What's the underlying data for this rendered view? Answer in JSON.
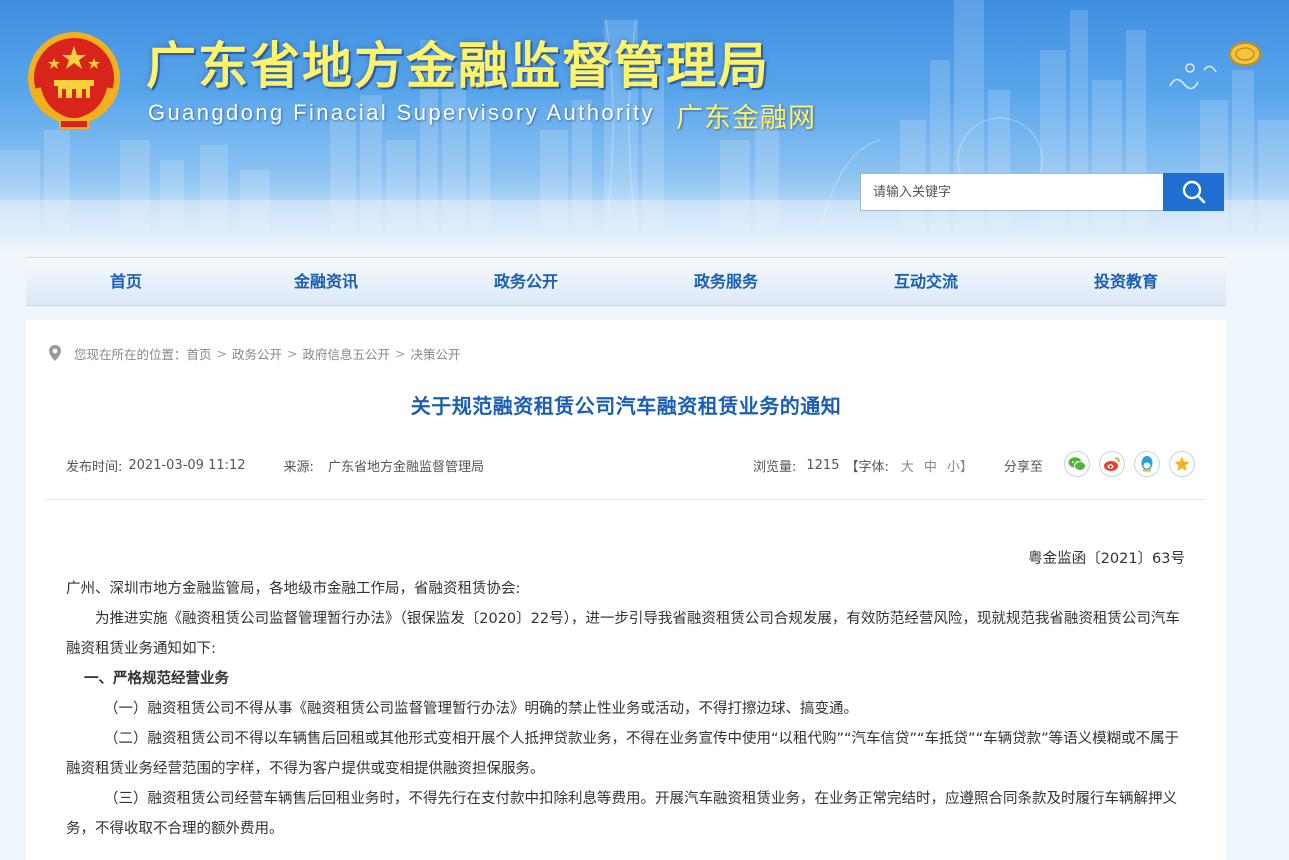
{
  "header": {
    "title": "广东省地方金融监督管理局",
    "subtitle": "Guangdong Finacial Supervisory Authority",
    "net_name": "广东金融网"
  },
  "search": {
    "placeholder": "请输入关键字"
  },
  "nav": {
    "items": [
      {
        "label": "首页"
      },
      {
        "label": "金融资讯"
      },
      {
        "label": "政务公开"
      },
      {
        "label": "政务服务"
      },
      {
        "label": "互动交流"
      },
      {
        "label": "投资教育"
      }
    ]
  },
  "breadcrumb": {
    "prefix": "您现在所在的位置：",
    "items": [
      "首页",
      "政务公开",
      "政府信息五公开",
      "决策公开"
    ],
    "separator": ">"
  },
  "article": {
    "title": "关于规范融资租赁公司汽车融资租赁业务的通知",
    "publish_label": "发布时间:",
    "publish_time": "2021-03-09 11:12",
    "source_label": "来源:",
    "source": "广东省地方金融监督管理局",
    "views_label": "浏览量:",
    "views": "1215",
    "font_label": "【字体:",
    "font_large": "大",
    "font_medium": "中",
    "font_small": "小】",
    "share_label": "分享至",
    "doc_number": "粤金监函〔2021〕63号",
    "paragraphs": [
      "广州、深圳市地方金融监管局，各地级市金融工作局，省融资租赁协会:",
      "为推进实施《融资租赁公司监督管理暂行办法》（银保监发〔2020〕22号），进一步引导我省融资租赁公司合规发展，有效防范经营风险，现就规范我省融资租赁公司汽车融资租赁业务通知如下:",
      "一、严格规范经营业务",
      "（一）融资租赁公司不得从事《融资租赁公司监督管理暂行办法》明确的禁止性业务或活动，不得打擦边球、搞变通。",
      "（二）融资租赁公司不得以车辆售后回租或其他形式变相开展个人抵押贷款业务，不得在业务宣传中使用“以租代购”“汽车信贷”“车抵贷”“车辆贷款”等语义模糊或不属于融资租赁业务经营范围的字样，不得为客户提供或变相提供融资担保服务。",
      "（三）融资租赁公司经营车辆售后回租业务时，不得先行在支付款中扣除利息等费用。开展汽车融资租赁业务，在业务正常完结时，应遵照合同条款及时履行车辆解押义务，不得收取不合理的额外费用。"
    ]
  },
  "share_icons": [
    "wechat-icon",
    "weibo-icon",
    "qq-icon",
    "qzone-icon"
  ],
  "colors": {
    "brand_blue": "#1b5fb5",
    "title_yellow": "#fff36a",
    "search_button": "#1e6fd1"
  }
}
